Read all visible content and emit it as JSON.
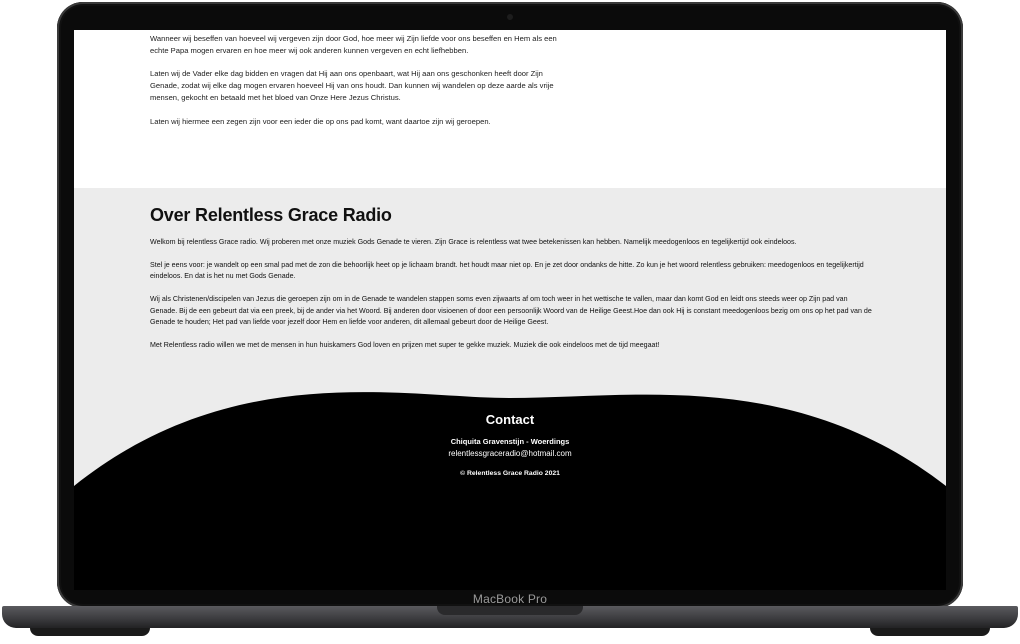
{
  "device": {
    "label": "MacBook Pro"
  },
  "intro": {
    "paragraphs": [
      "Wanneer wij beseffen van hoeveel wij vergeven zijn door God, hoe meer wij Zijn liefde voor ons beseffen en Hem als een echte Papa mogen ervaren en hoe meer wij ook anderen kunnen vergeven en echt liefhebben.",
      "Laten wij de Vader elke dag bidden en vragen dat Hij aan ons openbaart, wat Hij aan ons geschonken heeft door Zijn Genade, zodat wij elke dag mogen ervaren hoeveel Hij van ons houdt. Dan kunnen wij wandelen op deze aarde als vrije mensen, gekocht en betaald met het bloed van Onze Here Jezus Christus.",
      "Laten wij hiermee een zegen zijn voor een ieder die op ons pad komt, want daartoe zijn wij geroepen."
    ]
  },
  "about": {
    "heading": "Over Relentless Grace Radio",
    "paragraphs": [
      "Welkom bij relentless Grace radio. Wij proberen met onze muziek Gods Genade te vieren. Zijn Grace is relentless wat twee betekenissen kan hebben. Namelijk meedogenloos en tegelijkertijd ook eindeloos.",
      "Stel je eens voor: je wandelt op een smal pad met de zon die behoorlijk heet op je lichaam brandt. het houdt maar niet op. En je zet door ondanks de hitte. Zo kun je het woord relentless gebruiken: meedogenloos en tegelijkertijd eindeloos. En dat is het nu met Gods Genade.",
      "Wij als Christenen/discipelen van Jezus die geroepen zijn om in de Genade te wandelen stappen soms even zijwaarts af om toch weer in het wettische te vallen, maar dan komt God en leidt ons steeds weer op Zijn pad van Genade. Bij de een gebeurt dat via een preek, bij de ander via het Woord. Bij anderen door visioenen of door een persoonlijk Woord van de Heilige Geest.Hoe dan ook Hij is constant meedogenloos bezig om ons op het pad van de Genade te houden; Het pad van liefde voor jezelf door Hem en liefde voor anderen, dit allemaal gebeurt door de Heilige Geest.",
      "Met Relentless radio willen we met de mensen in hun huiskamers God loven en prijzen met super te gekke muziek. Muziek die ook eindeloos met de tijd meegaat!"
    ]
  },
  "contact": {
    "title": "Contact",
    "name": "Chiquita Gravenstijn - Woerdings",
    "email": "relentlessgraceradio@hotmail.com",
    "copyright": "© Relentless Grace Radio 2021"
  },
  "colors": {
    "about_bg": "#ececec",
    "footer_bg": "#000000",
    "text": "#111111"
  }
}
